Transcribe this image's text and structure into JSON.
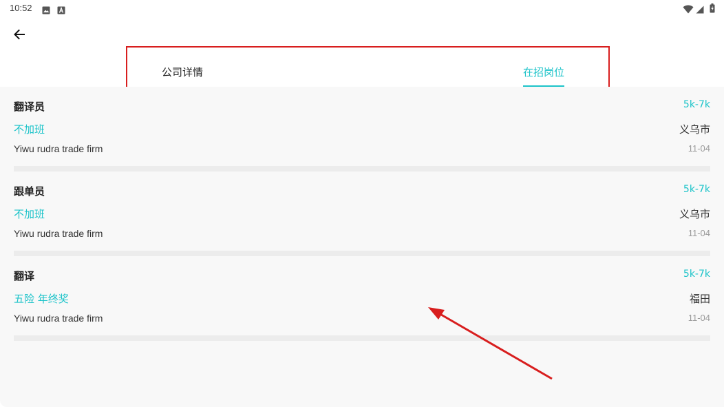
{
  "status_bar": {
    "time": "10:52",
    "icons_left": [
      "image-icon",
      "font-icon"
    ],
    "icons_right": [
      "wifi-icon",
      "signal-icon",
      "battery-icon"
    ]
  },
  "header": {
    "back_icon": "arrow-left-icon"
  },
  "tabs": [
    {
      "label": "公司详情",
      "active": false
    },
    {
      "label": "在招岗位",
      "active": true
    }
  ],
  "colors": {
    "accent": "#1cc3c9",
    "annotation_red": "#d81e1e"
  },
  "jobs": [
    {
      "title": "翻译员",
      "salary": "5k-7k",
      "tags": "不加班",
      "location": "义乌市",
      "company": "Yiwu rudra trade firm",
      "date": "11-04"
    },
    {
      "title": "跟单员",
      "salary": "5k-7k",
      "tags": "不加班",
      "location": "义乌市",
      "company": "Yiwu rudra trade firm",
      "date": "11-04"
    },
    {
      "title": "翻译",
      "salary": "5k-7k",
      "tags": "五险 年终奖",
      "location": "福田",
      "company": "Yiwu rudra trade firm",
      "date": "11-04"
    }
  ]
}
